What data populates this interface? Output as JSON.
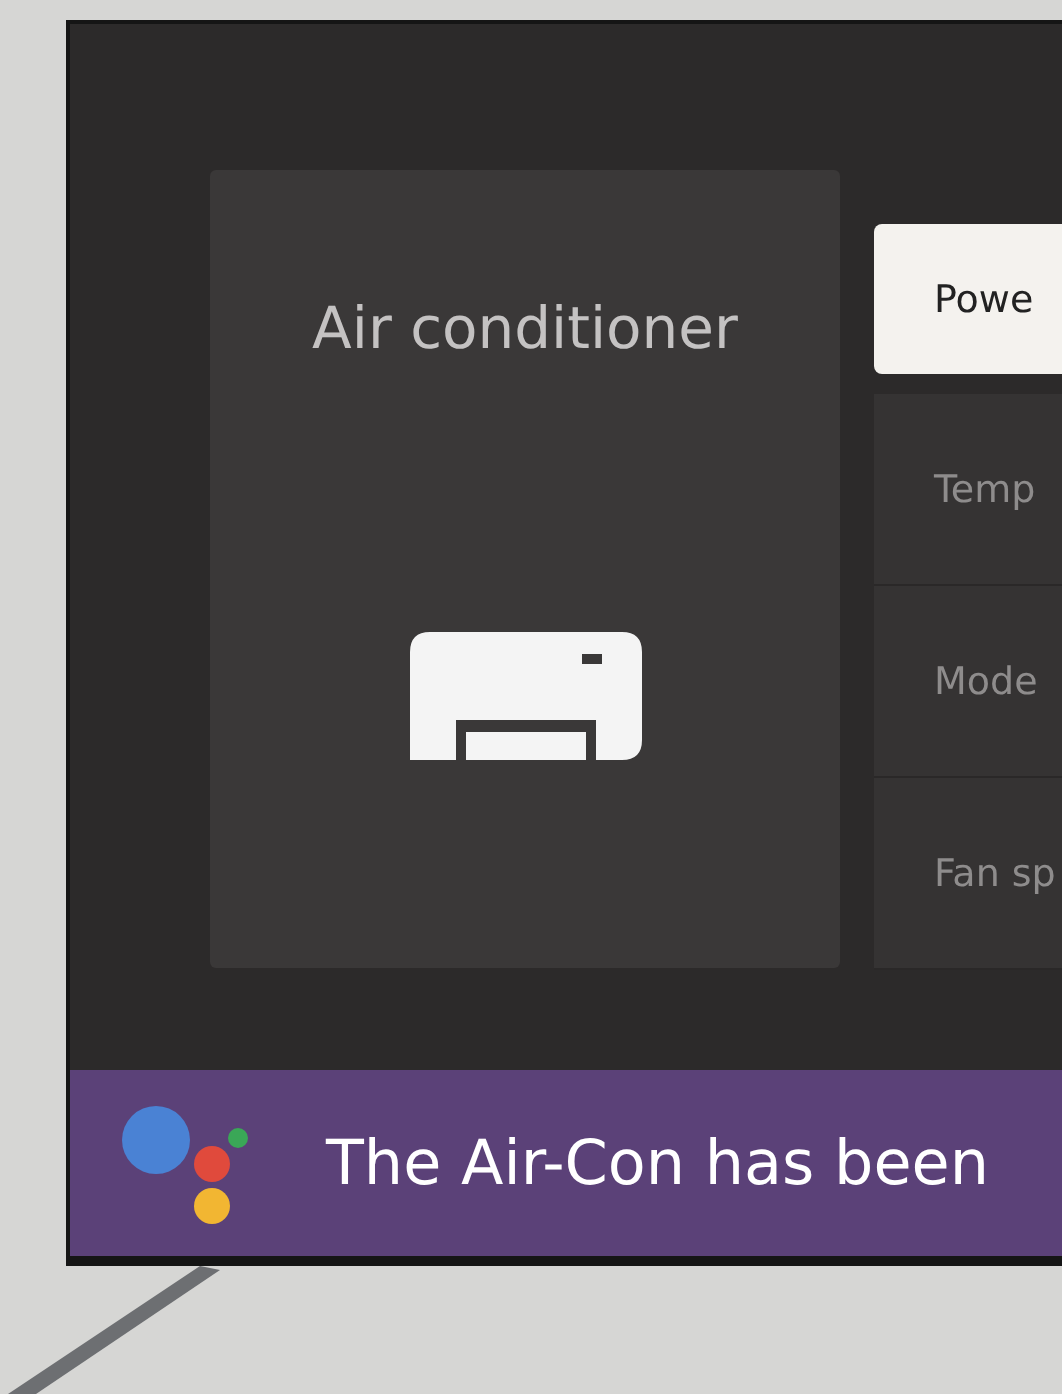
{
  "device_card": {
    "title": "Air conditioner"
  },
  "menu": [
    {
      "label": "Powe",
      "selected": true
    },
    {
      "label": "Temp",
      "selected": false
    },
    {
      "label": "Mode",
      "selected": false
    },
    {
      "label": "Fan sp",
      "selected": false
    }
  ],
  "assistant_banner": {
    "text": "The Air-Con has been"
  }
}
